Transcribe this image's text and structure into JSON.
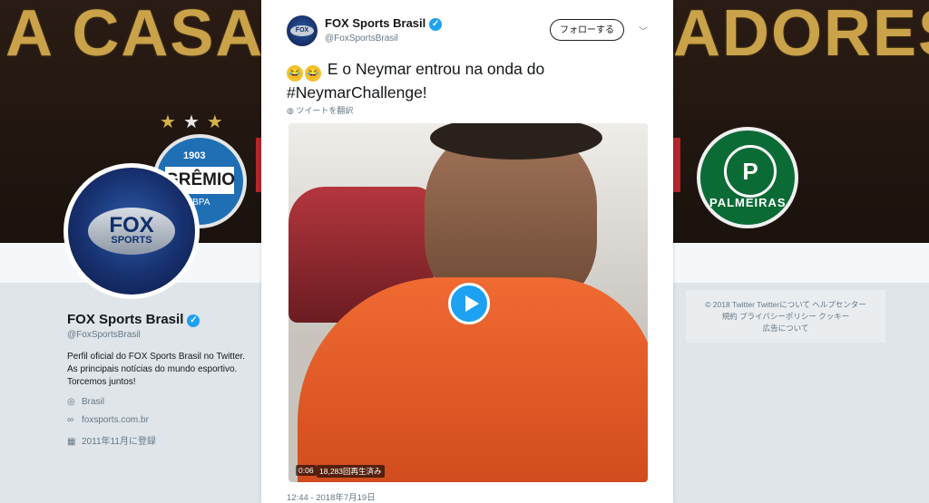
{
  "banner": {
    "left_text": "A CASA",
    "right_text": "ADORES",
    "gremio": {
      "year": "1903",
      "name": "GRÊMIO",
      "sub": "FBPA"
    },
    "palmeiras": {
      "name": "PALMEIRAS",
      "letter": "P"
    }
  },
  "profile": {
    "avatar_top": "FOX",
    "avatar_bottom": "SPORTS",
    "name": "FOX Sports Brasil",
    "handle": "@FoxSportsBrasil",
    "bio_lines": [
      "Perfil oficial do FOX Sports Brasil no Twitter.",
      "As principais notícias do mundo esportivo.",
      "Torcemos juntos!"
    ],
    "location": "Brasil",
    "website": "foxsports.com.br",
    "joined": "2011年11月に登録"
  },
  "footer": {
    "line1": "© 2018 Twitter   Twitterについて   ヘルプセンター",
    "line2": "規約   プライバシーポリシー   クッキー",
    "line3": "広告について"
  },
  "tweet": {
    "avatar_label": "FOX",
    "name": "FOX Sports Brasil",
    "handle": "@FoxSportsBrasil",
    "follow_label": "フォローする",
    "text_line1": "E o Neymar entrou na onda do",
    "text_line2": "#NeymarChallenge!",
    "translate_label": "ツイートを翻訳",
    "video_time": "0:06",
    "video_views": "18,283回再生済み",
    "timestamp": "12:44 - 2018年7月19日"
  },
  "colors": {
    "verified": "#1da1f2",
    "play_button": "#1da1f2",
    "banner_gold": "#c9a24a"
  }
}
